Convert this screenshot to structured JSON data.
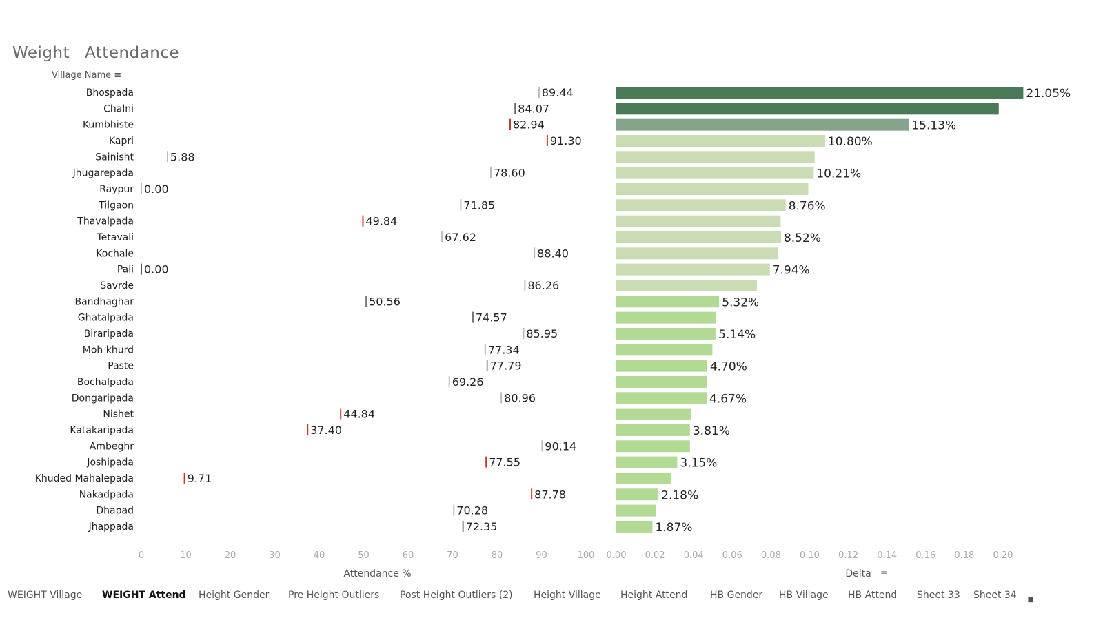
{
  "header": {
    "title_parts": [
      "Weight",
      "Attendance"
    ],
    "village_header": "Village Name"
  },
  "chart_data": {
    "type": "bar",
    "categories": [
      "Bhospada",
      "Chalni",
      "Kumbhiste",
      "Kapri",
      "Sainisht",
      "Jhugarepada",
      "Raypur",
      "Tilgaon",
      "Thavalpada",
      "Tetavali",
      "Kochale",
      "Pali",
      "Savrde",
      "Bandhaghar",
      "Ghatalpada",
      "Biraripada",
      "Moh khurd",
      "Paste",
      "Bochalpada",
      "Dongaripada",
      "Nishet",
      "Katakaripada",
      "Ambeghr",
      "Joshipada",
      "Khuded Mahalepada",
      "Nakadpada",
      "Dhapad",
      "Jhappada"
    ],
    "attendance": {
      "values": [
        89.44,
        84.07,
        82.94,
        91.3,
        5.88,
        78.6,
        0.0,
        71.85,
        49.84,
        67.62,
        88.4,
        0.0,
        86.26,
        50.56,
        74.57,
        85.95,
        77.34,
        77.79,
        69.26,
        80.96,
        44.84,
        37.4,
        90.14,
        77.55,
        9.71,
        87.78,
        70.28,
        72.35
      ],
      "labels": [
        "89.44",
        "84.07",
        "82.94",
        "91.30",
        "5.88",
        "78.60",
        "0.00",
        "71.85",
        "49.84",
        "67.62",
        "88.40",
        "0.00",
        "86.26",
        "50.56",
        "74.57",
        "85.95",
        "77.34",
        "77.79",
        "69.26",
        "80.96",
        "44.84",
        "37.40",
        "90.14",
        "77.55",
        "9.71",
        "87.78",
        "70.28",
        "72.35"
      ],
      "marker_colors": [
        "#bbbbbb",
        "#666666",
        "#c0392b",
        "#c0392b",
        "#bbbbbb",
        "#bbbbbb",
        "#bbbbbb",
        "#bbbbbb",
        "#c0392b",
        "#bbbbbb",
        "#bbbbbb",
        "#555555",
        "#bbbbbb",
        "#777777",
        "#777777",
        "#bbbbbb",
        "#bbbbbb",
        "#999999",
        "#bbbbbb",
        "#bbbbbb",
        "#c0392b",
        "#c0392b",
        "#bbbbbb",
        "#c0392b",
        "#c0392b",
        "#c0392b",
        "#bbbbbb",
        "#777777"
      ],
      "ticks": [
        "0",
        "10",
        "20",
        "30",
        "40",
        "50",
        "60",
        "70",
        "80",
        "90",
        "100"
      ],
      "xlim": [
        0,
        100
      ],
      "xlabel": "Attendance %"
    },
    "delta": {
      "values": [
        0.2105,
        0.1978,
        0.1513,
        0.108,
        0.1026,
        0.1021,
        0.0993,
        0.0876,
        0.085,
        0.0852,
        0.0838,
        0.0794,
        0.0727,
        0.0532,
        0.0514,
        0.0514,
        0.0497,
        0.047,
        0.047,
        0.0467,
        0.0386,
        0.0381,
        0.0381,
        0.0315,
        0.0285,
        0.0218,
        0.0204,
        0.0187
      ],
      "labels": [
        "21.05%",
        "",
        "15.13%",
        "10.80%",
        "",
        "10.21%",
        "",
        "8.76%",
        "",
        "8.52%",
        "",
        "7.94%",
        "",
        "5.32%",
        "",
        "5.14%",
        "",
        "4.70%",
        "",
        "4.67%",
        "",
        "3.81%",
        "",
        "3.15%",
        "",
        "2.18%",
        "",
        "1.87%"
      ],
      "colors": [
        "#4a7a58",
        "#4a7a58",
        "#84a48c",
        "#cadcb4",
        "#cadcb4",
        "#cadcb4",
        "#cadcb4",
        "#cadcb4",
        "#cadcb4",
        "#cadcb4",
        "#cadcb4",
        "#cadcb4",
        "#cadcb4",
        "#b2da94",
        "#b2da94",
        "#b2da94",
        "#b2da94",
        "#b2da94",
        "#b2da94",
        "#b2da94",
        "#b2da94",
        "#b2da94",
        "#b2da94",
        "#b2da94",
        "#b2da94",
        "#b2da94",
        "#b2da94",
        "#b2da94"
      ],
      "ticks": [
        "0.00",
        "0.02",
        "0.04",
        "0.06",
        "0.08",
        "0.10",
        "0.12",
        "0.14",
        "0.16",
        "0.18",
        "0.20"
      ],
      "xlim": [
        0,
        0.21
      ],
      "xlabel": "Delta"
    }
  },
  "tabs": [
    {
      "a": "WEIGHT",
      "b": "Village",
      "active": false
    },
    {
      "a": "WEIGHT",
      "b": "Attend",
      "active": true
    },
    {
      "a": "Height",
      "b": "Gender",
      "active": false
    },
    {
      "a": "Pre Height",
      "b": "Outliers",
      "active": false
    },
    {
      "a": "Post Height",
      "b": "Outliers (2)",
      "active": false
    },
    {
      "a": "Height",
      "b": "Village",
      "active": false
    },
    {
      "a": "Height",
      "b": "Attend",
      "active": false
    },
    {
      "a": "HB",
      "b": "Gender",
      "active": false
    },
    {
      "a": "HB",
      "b": "Village",
      "active": false
    },
    {
      "a": "HB",
      "b": "Attend",
      "active": false
    },
    {
      "a": "Sheet 33",
      "b": "",
      "active": false
    },
    {
      "a": "Sheet 34",
      "b": "",
      "active": false
    }
  ]
}
